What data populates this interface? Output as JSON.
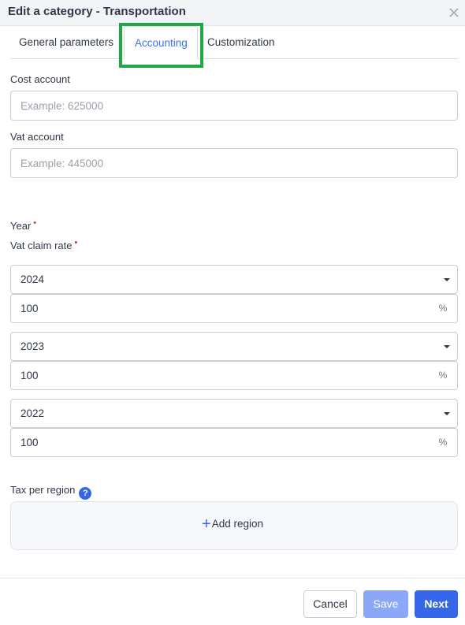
{
  "dialog": {
    "title": "Edit a category - Transportation"
  },
  "tabs": [
    {
      "label": "General parameters",
      "active": false
    },
    {
      "label": "Accounting",
      "active": true
    },
    {
      "label": "Customization",
      "active": false
    }
  ],
  "form": {
    "cost_account": {
      "label": "Cost account",
      "value": "",
      "placeholder": "Example: 625000"
    },
    "vat_account": {
      "label": "Vat account",
      "value": "",
      "placeholder": "Example: 445000"
    },
    "year_label": "Year",
    "vat_claim_rate_label": "Vat claim rate",
    "required_marker": "•",
    "rates": [
      {
        "year": "2024",
        "rate": "100",
        "unit": "%"
      },
      {
        "year": "2023",
        "rate": "100",
        "unit": "%"
      },
      {
        "year": "2022",
        "rate": "100",
        "unit": "%"
      }
    ],
    "tax_per_region_label": "Tax per region",
    "help_glyph": "?",
    "add_region_label": "Add region",
    "add_region_glyph": "+"
  },
  "footer": {
    "cancel_label": "Cancel",
    "save_label": "Save",
    "next_label": "Next"
  },
  "colors": {
    "accent": "#3565e8",
    "active_tab_text": "#3b6ff5",
    "save_disabled": "#8ba7f7",
    "required": "#d0352b",
    "annotation_highlight": "#1fa844"
  },
  "icons": {
    "close": "close-icon",
    "dropdown": "caret-down-icon",
    "help": "help-circle-icon",
    "add": "plus-icon"
  }
}
